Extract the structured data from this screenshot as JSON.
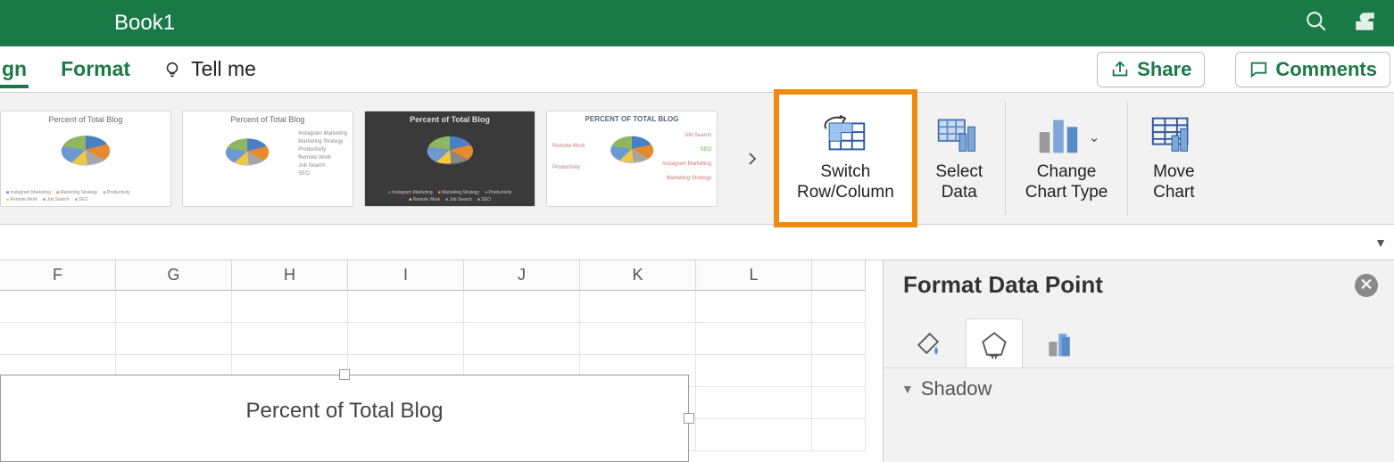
{
  "titlebar": {
    "document_title": "Book1"
  },
  "tabs": {
    "design": "gn",
    "format": "Format",
    "tell_me": "Tell me"
  },
  "actions": {
    "share": "Share",
    "comments": "Comments"
  },
  "ribbon": {
    "style_thumb_title": "Percent of Total Blog",
    "style_thumb_title_caps": "PERCENT OF TOTAL BLOG",
    "legend_items": [
      "Instagram Marketing",
      "Marketing Strategy",
      "Productivity",
      "Remote Work",
      "Job Search",
      "SEO"
    ],
    "switch_row_col": "Switch\nRow/Column",
    "select_data": "Select\nData",
    "change_chart_type": "Change\nChart Type",
    "move_chart": "Move\nChart"
  },
  "grid": {
    "columns": [
      "F",
      "G",
      "H",
      "I",
      "J",
      "K",
      "L",
      ""
    ]
  },
  "chart": {
    "title": "Percent of Total Blog"
  },
  "pane": {
    "title": "Format Data Point",
    "section_shadow": "Shadow"
  },
  "chart_data": {
    "type": "pie",
    "title": "Percent of Total Blog",
    "categories": [
      "Instagram Marketing",
      "Marketing Strategy",
      "Productivity",
      "Remote Work",
      "Job Search",
      "SEO"
    ],
    "values": [
      25,
      20,
      10,
      8,
      12,
      25
    ],
    "colors": [
      "#4a7fc4",
      "#e68a2e",
      "#a6a6a6",
      "#f2c744",
      "#6b99d0",
      "#8fb760"
    ]
  }
}
